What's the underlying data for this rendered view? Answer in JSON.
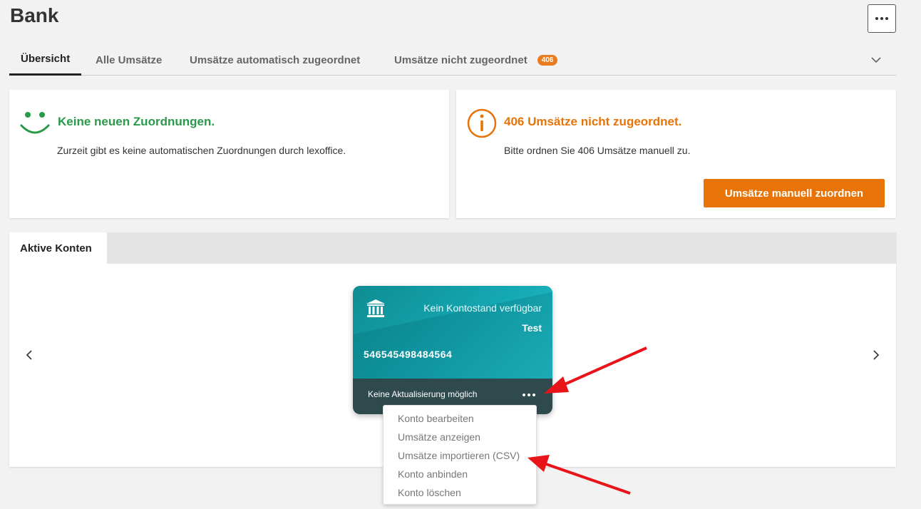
{
  "page": {
    "title": "Bank",
    "more_icon": "more-horizontal-icon"
  },
  "tabs": [
    {
      "label": "Übersicht",
      "active": true
    },
    {
      "label": "Alle Umsätze",
      "active": false
    },
    {
      "label": "Umsätze automatisch zugeordnet",
      "active": false
    },
    {
      "label": "Umsätze nicht zugeordnet",
      "badge": "406",
      "active": false
    }
  ],
  "auto_assign": {
    "icon": "smiley-icon",
    "heading": "Keine neuen Zuordnungen.",
    "text": "Zurzeit gibt es keine automatischen Zuordnungen durch lexoffice.",
    "color": "#2a9a4a"
  },
  "unassigned": {
    "icon": "info-icon",
    "heading": "406 Umsätze nicht zugeordnet.",
    "text": "Bitte ordnen Sie 406 Umsätze manuell zu.",
    "button_label": "Umsätze manuell zuordnen",
    "color": "#e87407"
  },
  "accounts": {
    "tab_label": "Aktive Konten",
    "card": {
      "bank_icon": "bank-building-icon",
      "balance": "Kein Kontostand verfügbar",
      "name": "Test",
      "number": "546545498484564",
      "status": "Keine Aktualisierung möglich"
    },
    "menu_items": [
      "Konto bearbeiten",
      "Umsätze anzeigen",
      "Umsätze importieren (CSV)",
      "Konto anbinden",
      "Konto löschen"
    ]
  },
  "colors": {
    "accent_orange": "#e87407",
    "success_green": "#2a9a4a",
    "card_teal": "#14a8b3",
    "annotation_red": "#e8141a"
  }
}
